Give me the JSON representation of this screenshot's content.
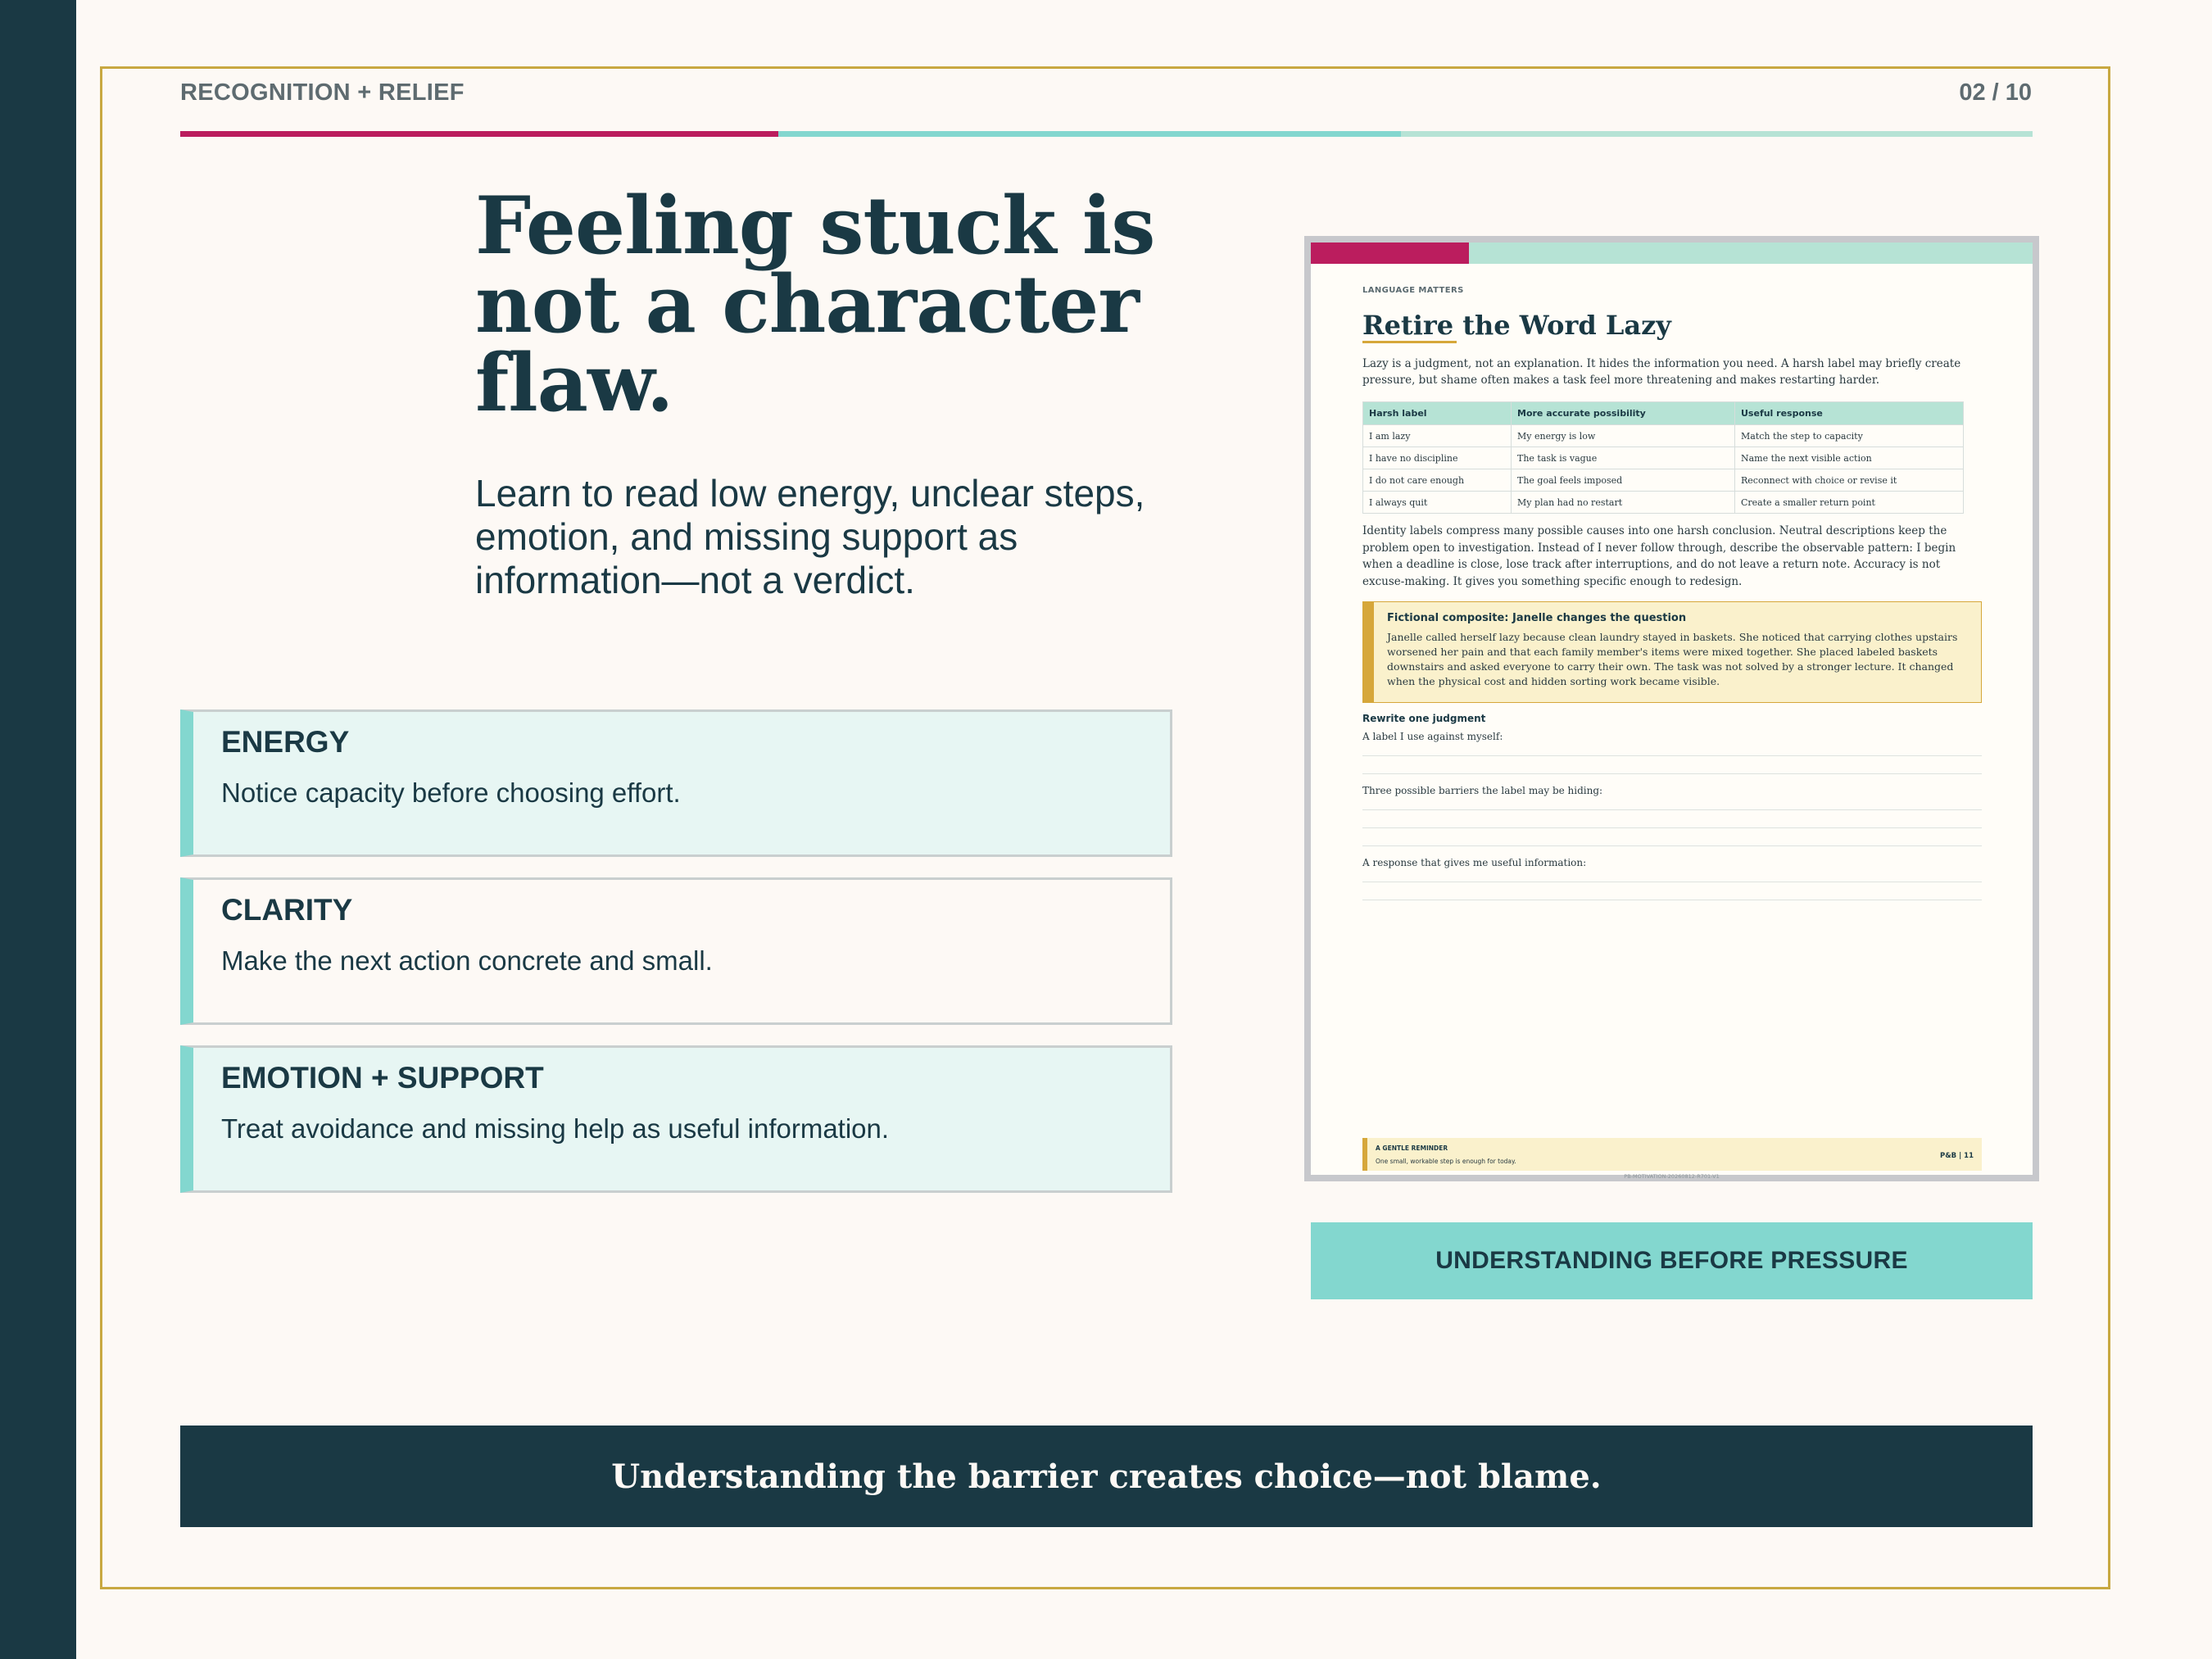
{
  "header": {
    "section_label": "RECOGNITION + RELIEF",
    "page_number": "02 / 10",
    "progress": 0.2
  },
  "headline": "Feeling stuck is not a character flaw.",
  "subhead": "Learn to read low energy, unclear steps, emotion, and missing support as information—not a verdict.",
  "cards": [
    {
      "title": "ENERGY",
      "text": "Notice capacity before choosing effort."
    },
    {
      "title": "CLARITY",
      "text": "Make the next action concrete and small."
    },
    {
      "title": "EMOTION + SUPPORT",
      "text": "Treat avoidance and missing help as useful information."
    }
  ],
  "document": {
    "kicker": "LANGUAGE MATTERS",
    "title": "Retire the Word Lazy",
    "intro": "Lazy is a judgment, not an explanation. It hides the information you need. A harsh label may briefly create pressure, but shame often makes a task feel more threatening and makes restarting harder.",
    "table": {
      "headers": [
        "Harsh label",
        "More accurate possibility",
        "Useful response"
      ],
      "rows": [
        [
          "I am lazy",
          "My energy is low",
          "Match the step to capacity"
        ],
        [
          "I have no discipline",
          "The task is vague",
          "Name the next visible action"
        ],
        [
          "I do not care enough",
          "The goal feels imposed",
          "Reconnect with choice or revise it"
        ],
        [
          "I always quit",
          "My plan had no restart",
          "Create a smaller return point"
        ]
      ]
    },
    "paragraph": "Identity labels compress many possible causes into one harsh conclusion. Neutral descriptions keep the problem open to investigation. Instead of I never follow through, describe the observable pattern: I begin when a deadline is close, lose track after interruptions, and do not leave a return note. Accuracy is not excuse-making. It gives you something specific enough to redesign.",
    "callout": {
      "title": "Fictional composite: Janelle changes the question",
      "body": "Janelle called herself lazy because clean laundry stayed in baskets. She noticed that carrying clothes upstairs worsened her pain and that each family member's items were mixed together. She placed labeled baskets downstairs and asked everyone to carry their own. The task was not solved by a stronger lecture. It changed when the physical cost and hidden sorting work became visible."
    },
    "exercise": {
      "title": "Rewrite one judgment",
      "prompts": [
        "A label I use against myself:",
        "Three possible barriers the label may be hiding:",
        "A response that gives me useful information:"
      ]
    },
    "footer": {
      "label": "A GENTLE REMINDER",
      "text": "One small, workable step is enough for today.",
      "page": "P&B  |  11",
      "code": "PB-MOTIVATION-20260812-R701-V1"
    }
  },
  "tag": "UNDERSTANDING BEFORE PRESSURE",
  "footer_quote": "Understanding the barrier creates choice—not blame.",
  "colors": {
    "navy": "#1a3944",
    "magenta": "#bb1d5e",
    "teal": "#83d7cf",
    "mint": "#b6e3d5",
    "gold": "#c8a841",
    "cream": "#fdf9f5"
  }
}
